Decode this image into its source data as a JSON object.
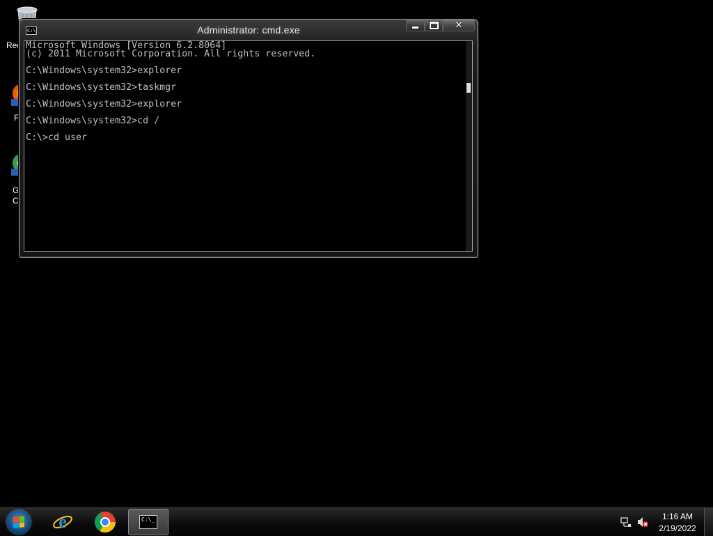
{
  "desktop": {
    "icons": [
      {
        "label": "Rec",
        "icon": "recycle-bin-icon"
      },
      {
        "label": "F",
        "icon": "firefox-icon"
      },
      {
        "label": "G\nC",
        "icon": "chrome-icon"
      }
    ]
  },
  "window": {
    "title": "Administrator: cmd.exe",
    "icon_text": "C:\\",
    "console_lines": [
      "Microsoft Windows [Version 6.2.8064]",
      "(c) 2011 Microsoft Corporation. All rights reserved.",
      "",
      "C:\\Windows\\system32>explorer",
      "",
      "C:\\Windows\\system32>taskmgr",
      "",
      "C:\\Windows\\system32>explorer",
      "",
      "C:\\Windows\\system32>cd /",
      "",
      "C:\\>cd user"
    ],
    "buttons": {
      "minimize": "minimize",
      "maximize": "maximize",
      "close": "✕"
    }
  },
  "taskbar": {
    "pinned": [
      {
        "name": "internet-explorer",
        "icon": "ie-icon"
      },
      {
        "name": "chrome",
        "icon": "chrome-icon"
      },
      {
        "name": "cmd",
        "icon": "cmd-icon",
        "label": "C:\\_",
        "active": true
      }
    ],
    "tray": {
      "icons": [
        "network-icon",
        "volume-muted-icon"
      ]
    },
    "clock": {
      "time": "1:16 AM",
      "date": "2/19/2022"
    }
  }
}
